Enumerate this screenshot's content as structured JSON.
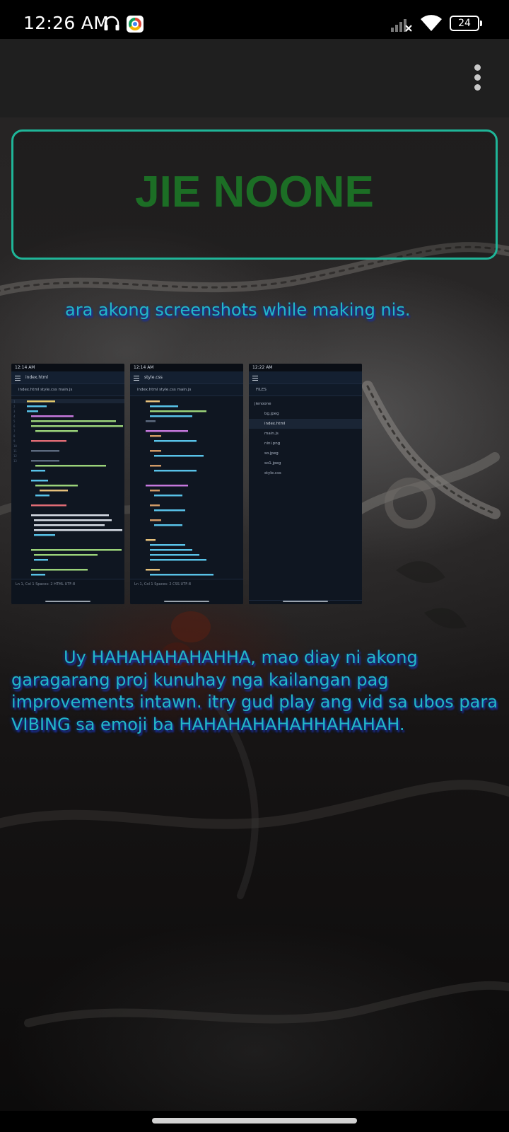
{
  "status_bar": {
    "time": "12:26 AM",
    "battery": "24",
    "icons": [
      "headphone-icon",
      "chrome-icon",
      "signal-icon",
      "wifi-icon",
      "battery-icon"
    ]
  },
  "app_bar": {
    "menu_icon": "more-vertical-icon"
  },
  "page": {
    "title": "JIE NOONE",
    "caption": "ara akong screenshots while making nis.",
    "body": "Uy HAHAHAHAHAHHA, mao diay ni akong garagarang proj kunuhay nga kailangan pag improvements intawn. itry gud play ang vid sa ubos para VIBING sa emoji ba HAHAHAHAHAHHAHAHAH.",
    "screenshots": [
      {
        "time": "12:14 AM",
        "file": "index.html",
        "tabs": "index.html    style.css    main.js",
        "footer": "Ln 1, Col 1          Spaces: 2    HTML   UTF-8"
      },
      {
        "time": "12:14 AM",
        "file": "style.css",
        "tabs": "index.html    style.css    main.js",
        "footer": "Ln 1, Col 1          Spaces: 2    CSS   UTF-8"
      },
      {
        "time": "12:22 AM",
        "file": "",
        "tabs": "FILES",
        "footer": "",
        "files": [
          "jienoone",
          "bg.jpeg",
          "index.html",
          "main.js",
          "nini.png",
          "so.jpeg",
          "so1.jpeg",
          "style.css"
        ]
      }
    ]
  },
  "colors": {
    "title": "#1c6e25",
    "border": "#1fb598",
    "text": "#22b7c9",
    "text_shadow": "#1b2f9a"
  }
}
